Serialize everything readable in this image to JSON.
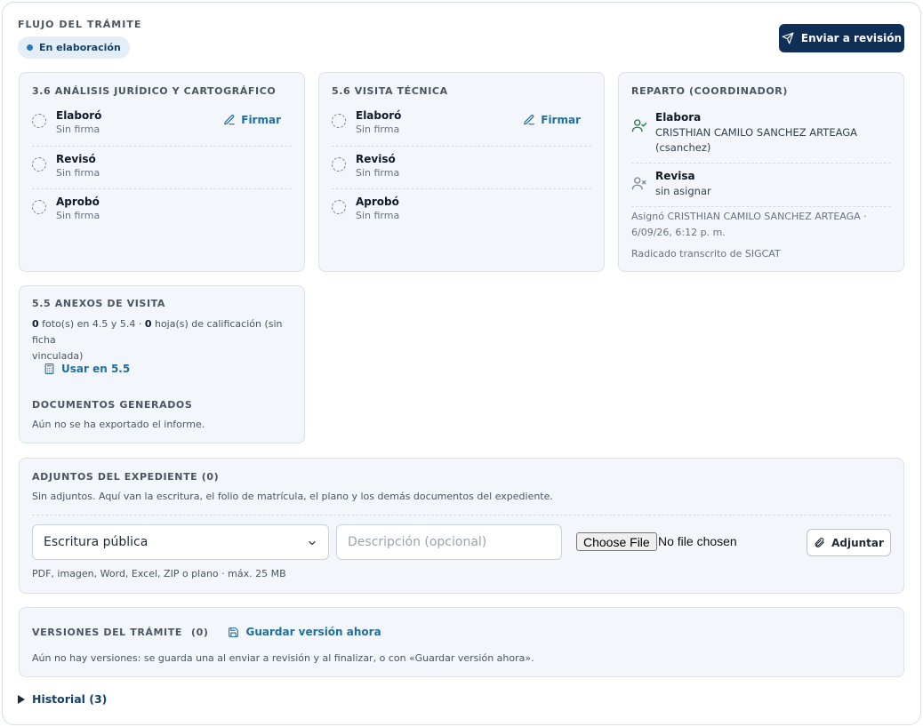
{
  "flow": {
    "title": "FLUJO DEL TRÁMITE",
    "status": "En elaboración",
    "send_button": "Enviar a revisión"
  },
  "cards": {
    "analisis": {
      "title": "3.6 ANÁLISIS JURÍDICO Y CARTOGRÁFICO",
      "rows": [
        {
          "role": "Elaboró",
          "state": "Sin firma"
        },
        {
          "role": "Revisó",
          "state": "Sin firma"
        },
        {
          "role": "Aprobó",
          "state": "Sin firma"
        }
      ],
      "sign_label": "Firmar"
    },
    "visita": {
      "title": "5.6 VISITA TÉCNICA",
      "rows": [
        {
          "role": "Elaboró",
          "state": "Sin firma"
        },
        {
          "role": "Revisó",
          "state": "Sin firma"
        },
        {
          "role": "Aprobó",
          "state": "Sin firma"
        }
      ],
      "sign_label": "Firmar"
    },
    "reparto": {
      "title": "REPARTO (COORDINADOR)",
      "elabora_role": "Elabora",
      "elabora_name": "CRISTHIAN CAMILO SANCHEZ ARTEAGA",
      "elabora_user": "(csanchez)",
      "revisa_role": "Revisa",
      "revisa_value": "sin asignar",
      "assigned_line1": "Asignó CRISTHIAN CAMILO SANCHEZ ARTEAGA ·",
      "assigned_line2": "6/09/26, 6:12 p. m.",
      "radicado": "Radicado transcrito de SIGCAT"
    },
    "anexos": {
      "title": "5.5 ANEXOS DE VISITA",
      "photos_count": "0",
      "photos_text": " foto(s) en 4.5 y 5.4 · ",
      "sheets_count": "0",
      "sheets_text_1": " hoja(s) de calificación (sin ficha",
      "sheets_text_2": "vinculada)",
      "use_link": "Usar en 5.5",
      "docs_title": "DOCUMENTOS GENERADOS",
      "docs_text": "Aún no se ha exportado el informe."
    }
  },
  "adjuntos": {
    "title": "ADJUNTOS DEL EXPEDIENTE (0)",
    "description": "Sin adjuntos. Aquí van la escritura, el folio de matrícula, el plano y los demás documentos del expediente.",
    "select_value": "Escritura pública",
    "desc_placeholder": "Descripción (opcional)",
    "file_button": "Choose File",
    "file_status": "No file chosen",
    "attach_button": "Adjuntar",
    "hint": "PDF, imagen, Word, Excel, ZIP o plano · máx. 25 MB"
  },
  "versiones": {
    "title": "VERSIONES DEL TRÁMITE",
    "count": "(0)",
    "save_link": "Guardar versión ahora",
    "text": "Aún no hay versiones: se guarda una al enviar a revisión y al finalizar, o con «Guardar versión ahora»."
  },
  "historial": {
    "label": "Historial (3)"
  }
}
